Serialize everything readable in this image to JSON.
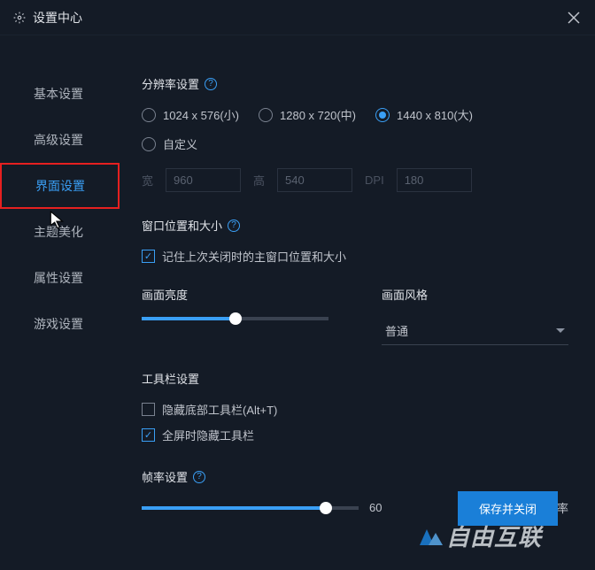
{
  "titlebar": {
    "title": "设置中心"
  },
  "sidebar": {
    "items": [
      {
        "label": "基本设置"
      },
      {
        "label": "高级设置"
      },
      {
        "label": "界面设置"
      },
      {
        "label": "主题美化"
      },
      {
        "label": "属性设置"
      },
      {
        "label": "游戏设置"
      }
    ]
  },
  "resolution": {
    "title": "分辨率设置",
    "options": [
      {
        "label": "1024 x 576(小)"
      },
      {
        "label": "1280 x 720(中)"
      },
      {
        "label": "1440 x 810(大)"
      }
    ],
    "custom_label": "自定义",
    "width_label": "宽",
    "width_value": "960",
    "height_label": "高",
    "height_value": "540",
    "dpi_label": "DPI",
    "dpi_value": "180"
  },
  "window": {
    "title": "窗口位置和大小",
    "remember_label": "记住上次关闭时的主窗口位置和大小"
  },
  "brightness": {
    "title": "画面亮度",
    "percent": 50
  },
  "style": {
    "title": "画面风格",
    "selected": "普通"
  },
  "toolbar": {
    "title": "工具栏设置",
    "hide_bottom_label": "隐藏底部工具栏(Alt+T)",
    "hide_fullscreen_label": "全屏时隐藏工具栏"
  },
  "fps": {
    "title": "帧率设置",
    "value": "60",
    "percent": 85,
    "show_fps_label": "显示帧率"
  },
  "footer": {
    "save_label": "保存并关闭"
  },
  "watermark": "自由互联"
}
